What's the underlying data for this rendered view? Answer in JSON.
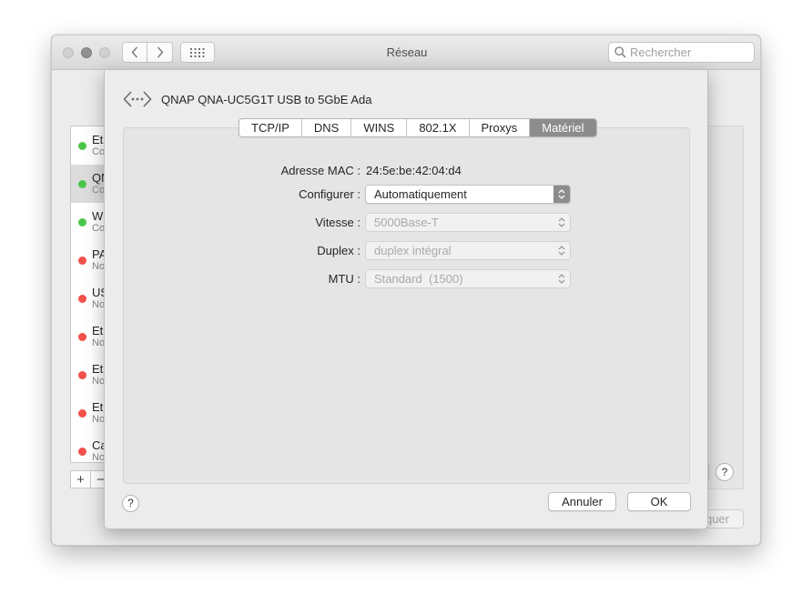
{
  "window": {
    "title": "Réseau"
  },
  "search": {
    "placeholder": "Rechercher"
  },
  "sidebar": {
    "services": [
      {
        "name": "Eth",
        "state": "Co",
        "status_color": "#4cc64a"
      },
      {
        "name": "QN",
        "state": "Co",
        "status_color": "#4cc64a"
      },
      {
        "name": "Wi",
        "state": "Co",
        "status_color": "#4cc64a"
      },
      {
        "name": "PA",
        "state": "No",
        "status_color": "#f2504b"
      },
      {
        "name": "US",
        "state": "No",
        "status_color": "#f2504b"
      },
      {
        "name": "Eth",
        "state": "No",
        "status_color": "#f2504b"
      },
      {
        "name": "Eth",
        "state": "No",
        "status_color": "#f2504b"
      },
      {
        "name": "Eth",
        "state": "No",
        "status_color": "#f2504b"
      },
      {
        "name": "Ca",
        "state": "No",
        "status_color": "#f2504b"
      }
    ],
    "add_label": "+",
    "remove_label": "−"
  },
  "background": {
    "help_label": "?",
    "apply_label": "quer"
  },
  "sheet": {
    "interface_title": "QNAP QNA-UC5G1T USB to 5GbE Ada",
    "interface_icon": "ethernet-arrows-icon",
    "tabs": [
      "TCP/IP",
      "DNS",
      "WINS",
      "802.1X",
      "Proxys",
      "Matériel"
    ],
    "active_tab": "Matériel",
    "fields": {
      "mac": {
        "label": "Adresse MAC :",
        "value": "24:5e:be:42:04:d4"
      },
      "configure": {
        "label": "Configurer :",
        "value": "Automatiquement"
      },
      "speed": {
        "label": "Vitesse :",
        "value": "5000Base-T"
      },
      "duplex": {
        "label": "Duplex :",
        "value": "duplex intégral"
      },
      "mtu": {
        "label": "MTU :",
        "value": "Standard  (1500)"
      }
    },
    "help_label": "?",
    "cancel_label": "Annuler",
    "ok_label": "OK"
  },
  "colors": {
    "accent_gray": "#8c8c8c",
    "status_green": "#4cc64a",
    "status_red": "#f2504b"
  }
}
